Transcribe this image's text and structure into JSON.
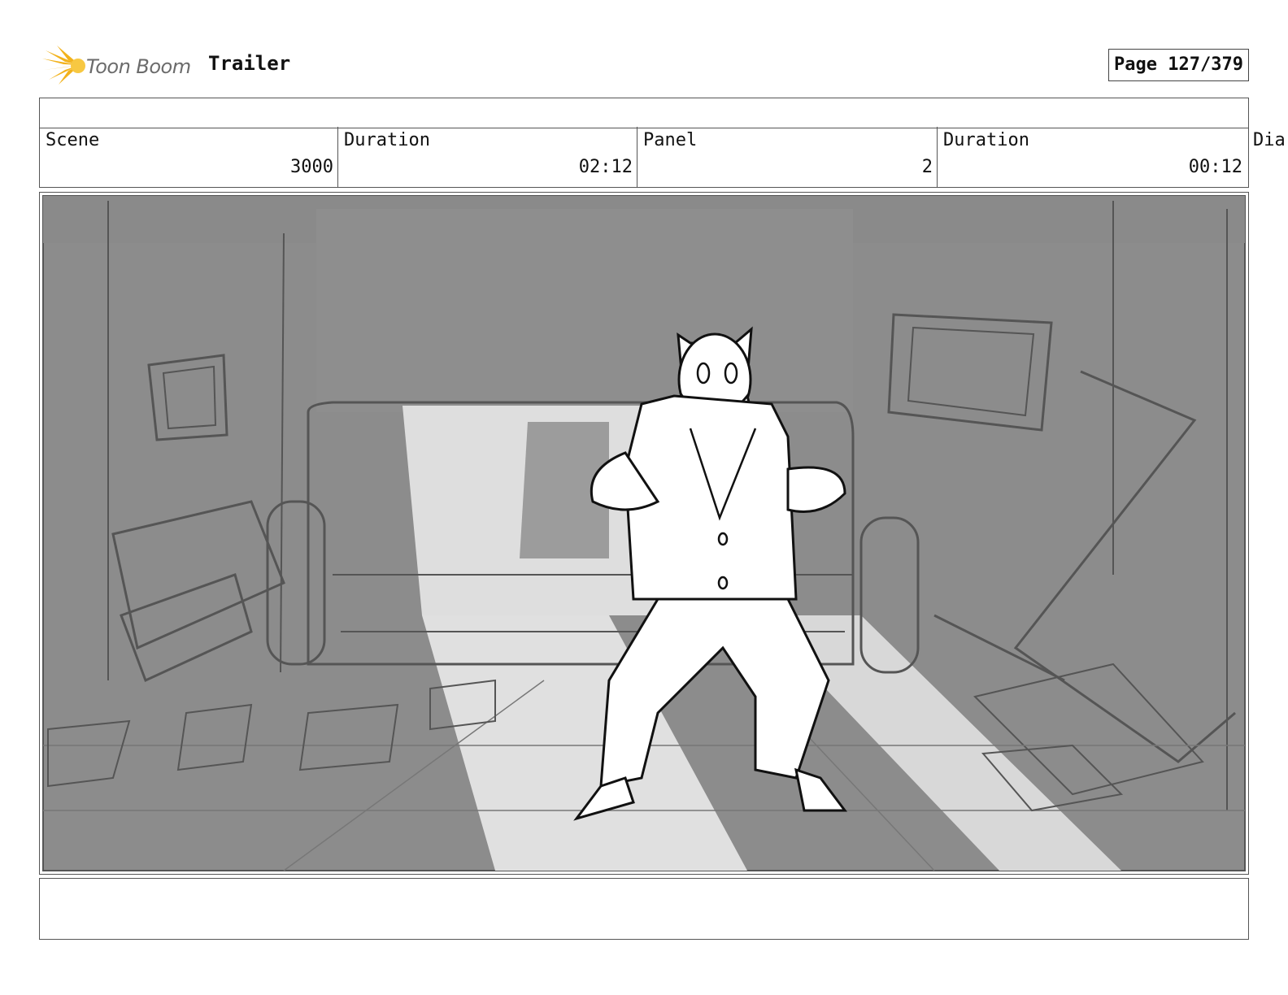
{
  "header": {
    "logo_text": "Toon Boom",
    "project_title": "Trailer",
    "page_indicator": "Page 127/379"
  },
  "info": {
    "scene_label": "Scene",
    "scene_value": "3000",
    "scene_duration_label": "Duration",
    "scene_duration_value": "02:12",
    "panel_label": "Panel",
    "panel_value": "2",
    "panel_duration_label": "Duration",
    "panel_duration_value": "00:12",
    "overflow_label": "Dia"
  },
  "colors": {
    "logo_accent": "#f2b21c",
    "panel_background": "#8c8c8c",
    "light_beam": "#dcdcdc"
  },
  "icons": {
    "logo": "toon-boom-starburst-icon"
  }
}
